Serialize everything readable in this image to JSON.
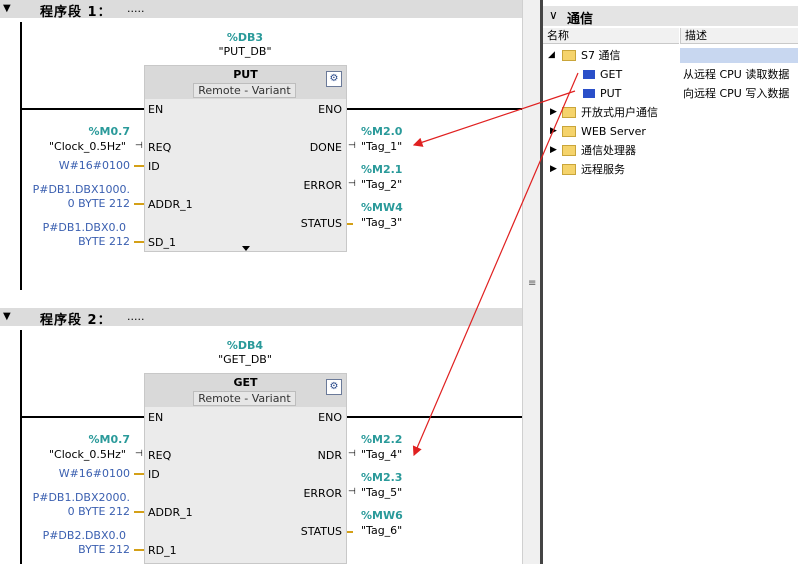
{
  "networks": [
    {
      "title": "程序段 1：",
      "comment": ".....",
      "db_addr": "%DB3",
      "db_name": "\"PUT_DB\"",
      "block_name": "PUT",
      "block_mode_left": "Remote",
      "block_mode_sep": "-",
      "block_mode_right": "Variant",
      "en": "EN",
      "eno": "ENO",
      "inputs": [
        {
          "pin": "REQ",
          "addr": "%M0.7",
          "tag": "\"Clock_0.5Hz\""
        },
        {
          "pin": "ID",
          "value": "W#16#0100"
        },
        {
          "pin": "ADDR_1",
          "line1": "P#DB1.DBX1000.",
          "line2": "0 BYTE 212"
        },
        {
          "pin": "SD_1",
          "line1": "P#DB1.DBX0.0",
          "line2": "BYTE 212"
        }
      ],
      "outputs": [
        {
          "pin": "DONE",
          "addr": "%M2.0",
          "tag": "\"Tag_1\""
        },
        {
          "pin": "ERROR",
          "addr": "%M2.1",
          "tag": "\"Tag_2\""
        },
        {
          "pin": "STATUS",
          "addr": "%MW4",
          "tag": "\"Tag_3\""
        }
      ]
    },
    {
      "title": "程序段 2：",
      "comment": ".....",
      "db_addr": "%DB4",
      "db_name": "\"GET_DB\"",
      "block_name": "GET",
      "block_mode_left": "Remote",
      "block_mode_sep": "-",
      "block_mode_right": "Variant",
      "en": "EN",
      "eno": "ENO",
      "inputs": [
        {
          "pin": "REQ",
          "addr": "%M0.7",
          "tag": "\"Clock_0.5Hz\""
        },
        {
          "pin": "ID",
          "value": "W#16#0100"
        },
        {
          "pin": "ADDR_1",
          "line1": "P#DB1.DBX2000.",
          "line2": "0 BYTE 212"
        },
        {
          "pin": "RD_1",
          "line1": "P#DB2.DBX0.0",
          "line2": "BYTE 212"
        }
      ],
      "outputs": [
        {
          "pin": "NDR",
          "addr": "%M2.2",
          "tag": "\"Tag_4\""
        },
        {
          "pin": "ERROR",
          "addr": "%M2.3",
          "tag": "\"Tag_5\""
        },
        {
          "pin": "STATUS",
          "addr": "%MW6",
          "tag": "\"Tag_6\""
        }
      ]
    }
  ],
  "panel": {
    "title": "通信",
    "col_name": "名称",
    "col_desc": "描述",
    "tree": [
      {
        "label": "S7 通信",
        "desc": ""
      },
      {
        "label": "GET",
        "desc": "从远程 CPU 读取数据"
      },
      {
        "label": "PUT",
        "desc": "向远程 CPU 写入数据"
      },
      {
        "label": "开放式用户通信",
        "desc": ""
      },
      {
        "label": "WEB Server",
        "desc": ""
      },
      {
        "label": "通信处理器",
        "desc": ""
      },
      {
        "label": "远程服务",
        "desc": ""
      }
    ]
  },
  "colors": {
    "accent_teal": "#2a9a9a",
    "address_blue": "#3a5fb0",
    "arrow_red": "#e02020",
    "wire_orange": "#d4a017"
  }
}
